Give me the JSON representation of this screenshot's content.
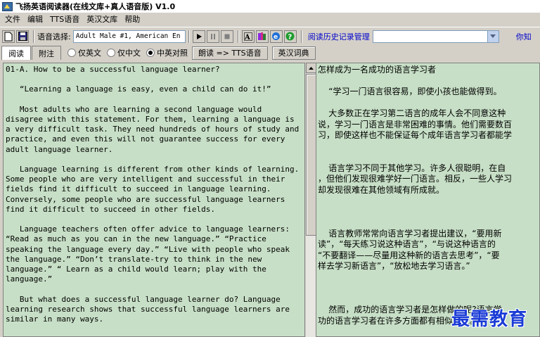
{
  "window": {
    "title": "飞扬英语阅读器(在线文库+真人语音版) V1.0"
  },
  "menu": [
    "文件",
    "编辑",
    "TTS语音",
    "英汉文库",
    "帮助"
  ],
  "toolbar": {
    "voice_label": "语音选择:",
    "voice_value": "Adult Male #1, American En",
    "history_label": "阅读历史记录管理",
    "history_value": "",
    "right_link": "你知"
  },
  "tabs": [
    "阅读",
    "附注"
  ],
  "display_options": {
    "options": [
      "仅英文",
      "仅中文",
      "中英对照"
    ],
    "selected": "中英对照"
  },
  "buttons": {
    "translate": "朗读 => TTS语音",
    "dictionary": "英汉词典"
  },
  "english_text": "01-A. How to be a successful language learner?\n\n   “Learning a language is easy, even a child can do it!”\n\n   Most adults who are learning a second language would disagree with this statement. For them, learning a language is a very difficult task. They need hundreds of hours of study and practice, and even this will not guarantee success for every adult language learner.\n\n   Language learning is different from other kinds of learning. Some people who are very intelligent and successful in their fields find it difficult to succeed in language learning. Conversely, some people who are successful language learners find it difficult to succeed in other fields.\n\n   Language teachers often offer advice to language learners: “Read as much as you can in the new language.” “Practice speaking the language every day.” “Live with people who speak the language.” “Don’t translate-try to think in the new language.” “ Learn as a child would learn; play with the language.”\n\n   But what does a successful language learner do? Language learning research shows that successful language learners are similar in many ways.",
  "chinese_text": "怎样成为一名成功的语言学习者\n\n    “学习一门语言很容易，即使小孩也能做得到。\n\n    大多数正在学习第二语言的成年人会不同意这种\n说，学习一门语言是非常困难的事情。他们需要数百\n习，即使这样也不能保证每个成年语言学习者都能学\n\n\n    语言学习不同于其他学习。许多人很聪明，在自\n，但他们发现很难学好一门语言。相反，一些人学习\n却发现很难在其他领域有所成就。\n\n\n\n    语言教师常常向语言学习者提出建议，“要用新\n读”，“每天练习说这种语言”，“与说这种语言的\n“不要翻译——尽量用这种新的语言去思考”，“要\n样去学习新语言”，“放松地去学习语言。”\n\n\n\n    然而，成功的语言学习者是怎样做的呢?语言学\n功的语言学习者在许多方面都有相似之处。",
  "watermark": "最需教育"
}
